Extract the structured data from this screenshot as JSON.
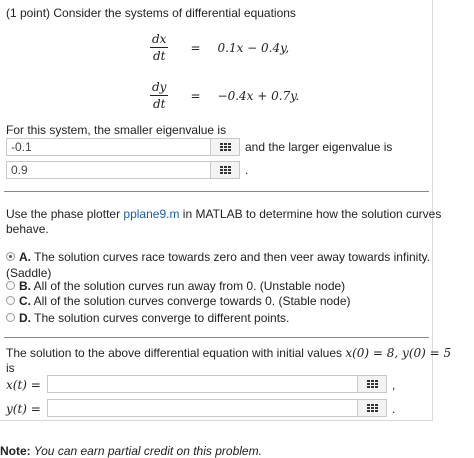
{
  "question": {
    "header": "(1 point) Consider the systems of differential equations",
    "eq1": {
      "num": "dx",
      "den": "dt",
      "rhs": "0.1x − 0.4y,"
    },
    "eq2": {
      "num": "dy",
      "den": "dt",
      "rhs": "−0.4x + 0.7y."
    },
    "equals": "="
  },
  "eigen": {
    "prompt": "For this system, the smaller eigenvalue is",
    "smaller_value": "-0.1",
    "larger_prompt": "and the larger eigenvalue is",
    "larger_value": "0.9",
    "end_punct": "."
  },
  "phase": {
    "text_before_link": "Use the phase plotter ",
    "link": "pplane9.m",
    "text_after_link": " in MATLAB to determine how the solution curves",
    "line2": "behave.",
    "options": [
      {
        "letter": "A.",
        "text": "The solution curves race towards zero and then veer away towards infinity.",
        "text2": "(Saddle)"
      },
      {
        "letter": "B.",
        "text": "All of the solution curves run away from 0. (Unstable node)"
      },
      {
        "letter": "C.",
        "text": "All of the solution curves converge towards 0. (Stable node)"
      },
      {
        "letter": "D.",
        "text": "The solution curves converge to different points."
      }
    ]
  },
  "solution": {
    "line1": "The solution to the above differential equation with initial values",
    "initial": "x(0) = 8,  y(0) = 5",
    "line2": "is",
    "x_label": "x(t) =",
    "x_value": "",
    "x_end": ",",
    "y_label": "y(t) =",
    "y_value": "",
    "y_end": "."
  },
  "note": {
    "bold": "Note:",
    "text": " You can earn partial credit on this problem."
  }
}
